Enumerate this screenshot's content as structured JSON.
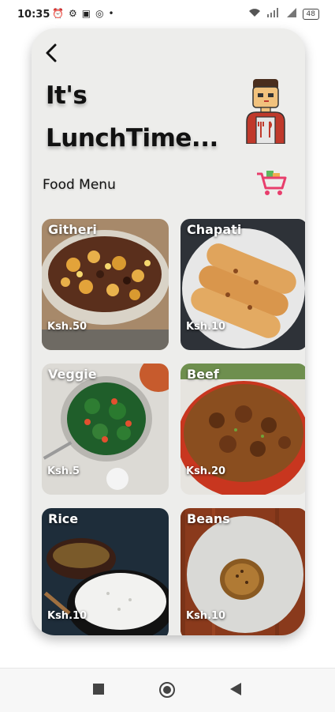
{
  "status_bar": {
    "time": "10:35",
    "battery": "48"
  },
  "header": {
    "title_line1": "It's",
    "title_line2": "LunchTime..."
  },
  "menu": {
    "section_title": "Food Menu",
    "items": [
      {
        "name": "Githeri",
        "price": "Ksh.50"
      },
      {
        "name": "Chapati",
        "price": "Ksh.10"
      },
      {
        "name": "Veggie",
        "price": "Ksh.5"
      },
      {
        "name": "Beef",
        "price": "Ksh.20"
      },
      {
        "name": "Rice",
        "price": "Ksh.10"
      },
      {
        "name": "Beans",
        "price": "Ksh.10"
      }
    ]
  },
  "icons": {
    "back": "back-arrow-icon",
    "avatar": "chef-avatar-icon",
    "cart": "shopping-cart-icon",
    "nav_recents": "stop-square-icon",
    "nav_home": "home-circle-icon",
    "nav_back": "back-triangle-icon"
  }
}
